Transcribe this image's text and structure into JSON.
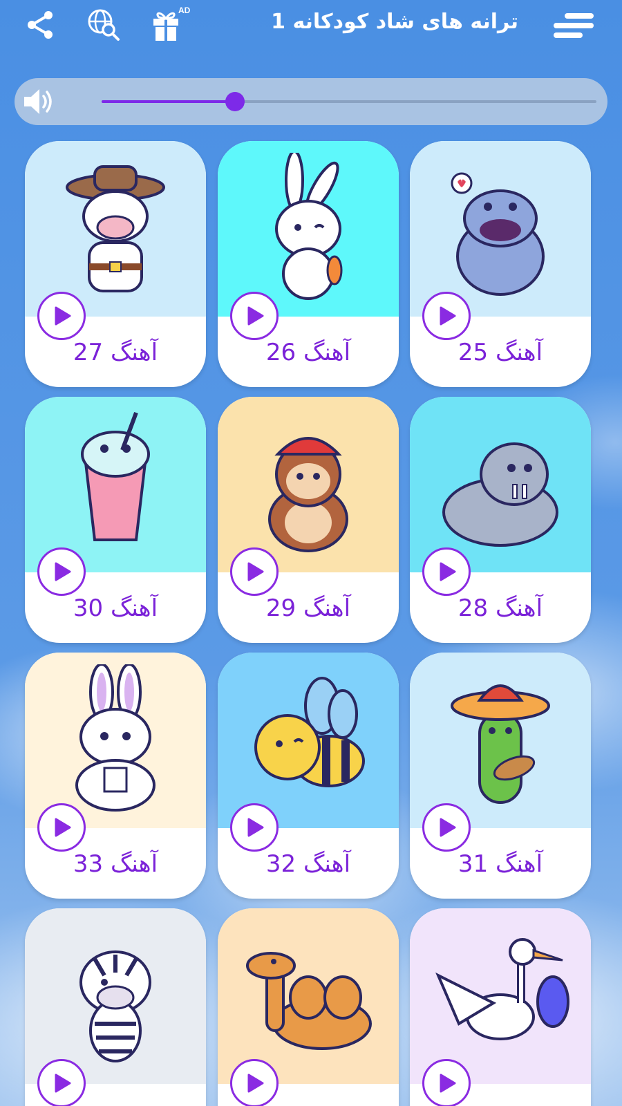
{
  "app_title": "ترانه های شاد  کودکانه 1",
  "header": {
    "ad_badge": "AD",
    "icons": [
      "share-icon",
      "web-search-icon",
      "gift-icon",
      "menu-icon"
    ]
  },
  "volume": {
    "level": 0.27,
    "accent": "#7d2ae8"
  },
  "songs": [
    {
      "label": "آهنگ 25",
      "bg": "#cdebfb",
      "art": "hippo"
    },
    {
      "label": "آهنگ 26",
      "bg": "#5ef8fb",
      "art": "rabbit"
    },
    {
      "label": "آهنگ 27",
      "bg": "#cdebfb",
      "art": "cowboy-cow"
    },
    {
      "label": "آهنگ 28",
      "bg": "#6fe3f6",
      "art": "walrus"
    },
    {
      "label": "آهنگ 29",
      "bg": "#fbe2ac",
      "art": "monkey"
    },
    {
      "label": "آهنگ 30",
      "bg": "#8ef3f5",
      "art": "drink-cup"
    },
    {
      "label": "آهنگ 31",
      "bg": "#cdebfb",
      "art": "cactus"
    },
    {
      "label": "آهنگ 32",
      "bg": "#7fd1fb",
      "art": "bee"
    },
    {
      "label": "آهنگ 33",
      "bg": "#fff3dc",
      "art": "bunny"
    },
    {
      "label": "",
      "bg": "#f1e4fb",
      "art": "stork"
    },
    {
      "label": "",
      "bg": "#fde3bd",
      "art": "camel"
    },
    {
      "label": "",
      "bg": "#e8ecf2",
      "art": "zebra"
    }
  ],
  "colors": {
    "label": "#7b22d8",
    "play_ring": "#8a2be2",
    "background": "#4a8fe3"
  }
}
